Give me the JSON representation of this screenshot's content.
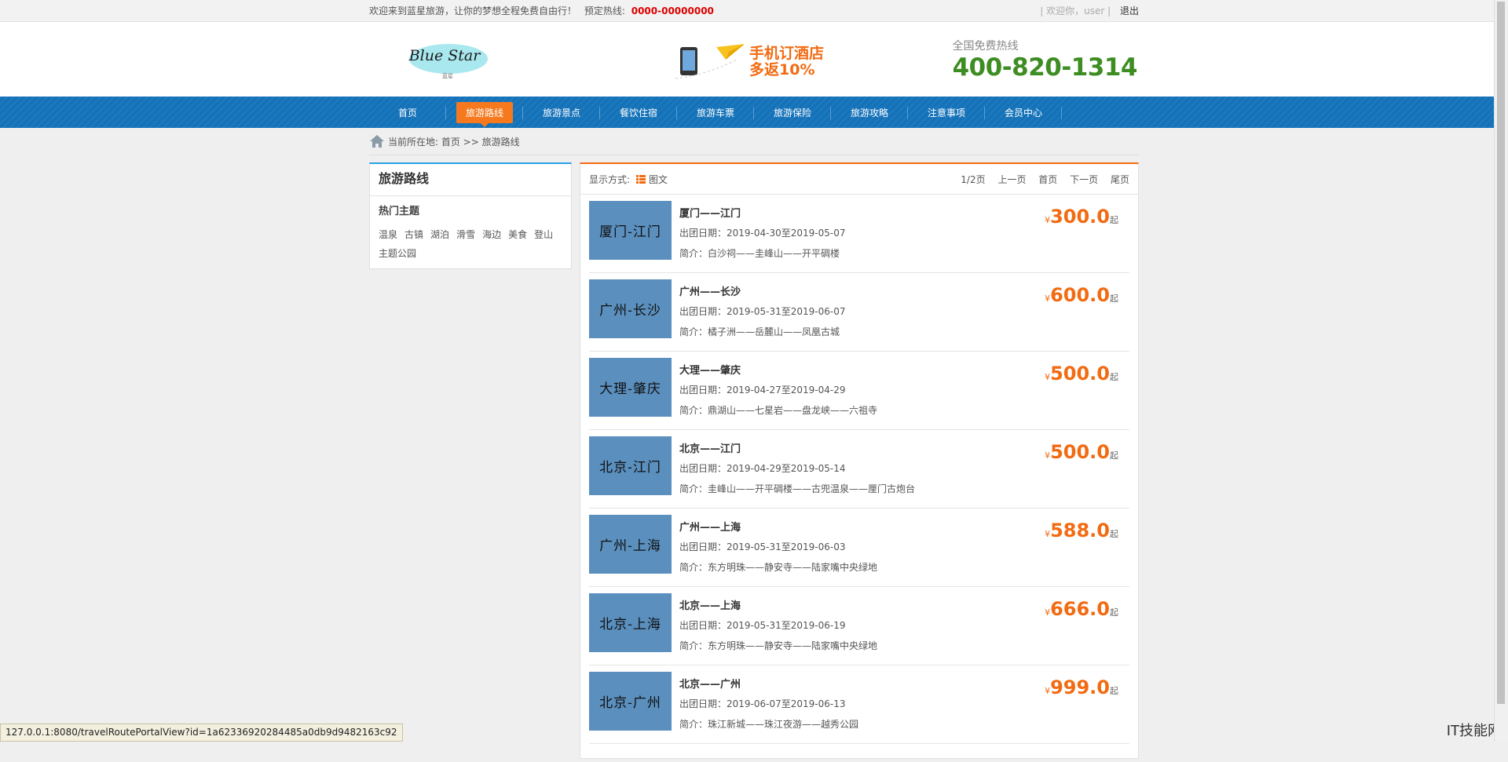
{
  "topbar": {
    "welcome": "欢迎来到蓝星旅游，让你的梦想全程免费自由行！",
    "hotline_label": "预定热线:",
    "hotline_number": "0000-00000000",
    "user_greeting": "| 欢迎你，user |",
    "logout": "退出"
  },
  "header": {
    "logo_text": "Blue Star",
    "logo_sub": "蓝星",
    "promo_line1": "手机订酒店",
    "promo_line2": "多返10%",
    "free_hotline_label": "全国免费热线",
    "free_hotline_number": "400-820-1314"
  },
  "nav": {
    "items": [
      "首页",
      "旅游路线",
      "旅游景点",
      "餐饮住宿",
      "旅游车票",
      "旅游保险",
      "旅游攻略",
      "注意事项",
      "会员中心"
    ],
    "active": "旅游路线"
  },
  "breadcrumb": {
    "text": "当前所在地: 首页 >> 旅游路线"
  },
  "sidebar": {
    "title": "旅游路线",
    "subtitle": "热门主题",
    "tags": [
      "温泉",
      "古镇",
      "湖泊",
      "滑雪",
      "海边",
      "美食",
      "登山",
      "主题公园"
    ]
  },
  "toolbar": {
    "mode_label": "显示方式:",
    "mode_value": "图文",
    "page_info": "1/2页",
    "prev": "上一页",
    "first": "首页",
    "next": "下一页",
    "last": "尾页"
  },
  "routes": [
    {
      "thumb": "厦门-江门",
      "title": "厦门——江门",
      "date": "出团日期：2019-04-30至2019-05-07",
      "brief": "简介：白沙祠——圭峰山——开平碉楼",
      "price": "300.0"
    },
    {
      "thumb": "广州-长沙",
      "title": "广州——长沙",
      "date": "出团日期：2019-05-31至2019-06-07",
      "brief": "简介：橘子洲——岳麓山——凤凰古城",
      "price": "600.0"
    },
    {
      "thumb": "大理-肇庆",
      "title": "大理——肇庆",
      "date": "出团日期：2019-04-27至2019-04-29",
      "brief": "简介：鼎湖山——七星岩——盘龙峡——六祖寺",
      "price": "500.0"
    },
    {
      "thumb": "北京-江门",
      "title": "北京——江门",
      "date": "出团日期：2019-04-29至2019-05-14",
      "brief": "简介：圭峰山——开平碉楼——古兜温泉——厘门古炮台",
      "price": "500.0"
    },
    {
      "thumb": "广州-上海",
      "title": "广州——上海",
      "date": "出团日期：2019-05-31至2019-06-03",
      "brief": "简介：东方明珠——静安寺——陆家嘴中央绿地",
      "price": "588.0"
    },
    {
      "thumb": "北京-上海",
      "title": "北京——上海",
      "date": "出团日期：2019-05-31至2019-06-19",
      "brief": "简介：东方明珠——静安寺——陆家嘴中央绿地",
      "price": "666.0"
    },
    {
      "thumb": "北京-广州",
      "title": "北京——广州",
      "date": "出团日期：2019-06-07至2019-06-13",
      "brief": "简介：珠江新城——珠江夜游——越秀公园",
      "price": "999.0"
    }
  ],
  "price_currency": "¥",
  "price_suffix": "起",
  "status_url": "127.0.0.1:8080/travelRoutePortalView?id=1a62336920284485a0db9d9482163c92",
  "watermark": "IT技能网",
  "colors": {
    "nav_blue": "#1472b9",
    "accent_orange": "#f26b12",
    "hotline_green": "#3d8d22",
    "thumb_blue": "#5a8fbe"
  }
}
